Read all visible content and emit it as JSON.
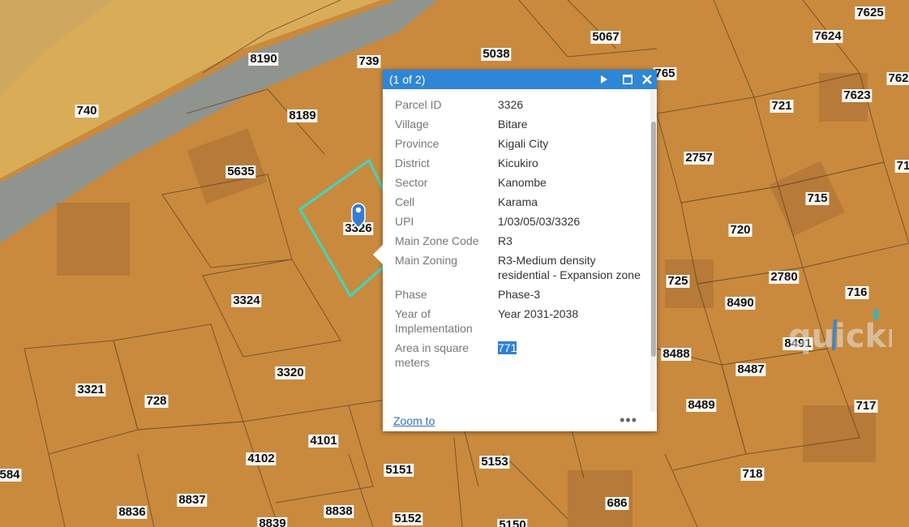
{
  "popup": {
    "counter": "(1 of 2)",
    "icons": {
      "next": "next-arrow-icon",
      "maximize": "maximize-icon",
      "close": "close-icon"
    },
    "fields": [
      {
        "key": "Parcel ID",
        "value": "3326"
      },
      {
        "key": "Village",
        "value": "Bitare"
      },
      {
        "key": "Province",
        "value": "Kigali City"
      },
      {
        "key": "District",
        "value": "Kicukiro"
      },
      {
        "key": "Sector",
        "value": "Kanombe"
      },
      {
        "key": "Cell",
        "value": "Karama"
      },
      {
        "key": "UPI",
        "value": "1/03/05/03/3326"
      },
      {
        "key": "Main Zone Code",
        "value": "R3"
      },
      {
        "key": "Main Zoning",
        "value": "R3-Medium density residential - Expansion zone"
      },
      {
        "key": "Phase",
        "value": "Phase-3"
      },
      {
        "key": "Year of Implementation",
        "value": "Year 2031-2038"
      },
      {
        "key": "Area in square meters",
        "value": "771"
      }
    ],
    "zoom_link": "Zoom to",
    "more": "•••"
  },
  "map": {
    "colors": {
      "zoning": "#c98a3e",
      "yellow_zone": "#d9ad58",
      "road": "#7d8a8c",
      "selected_outline": "#3fd6c2",
      "pin": "#3a7bd5"
    },
    "parcels": [
      "7625",
      "5067",
      "5038",
      "739",
      "8190",
      "7624",
      "765",
      "762",
      "740",
      "8189",
      "721",
      "7623",
      "5635",
      "2757",
      "71",
      "715",
      "3326",
      "720",
      "3324",
      "725",
      "2780",
      "716",
      "8490",
      "3320",
      "8488",
      "8491",
      "8487",
      "3321",
      "728",
      "8489",
      "717",
      "4101",
      "4102",
      "5151",
      "5153",
      "718",
      "584",
      "8837",
      "8836",
      "8838",
      "5152",
      "686",
      "8839",
      "5150"
    ]
  },
  "watermark": "quickr"
}
